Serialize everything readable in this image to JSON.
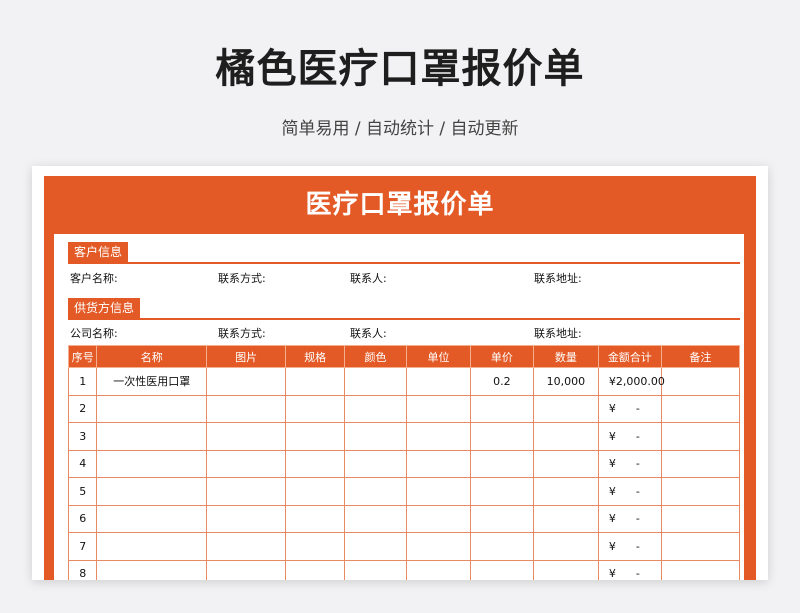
{
  "header": {
    "title": "橘色医疗口罩报价单",
    "subtitle": "简单易用 / 自动统计 / 自动更新"
  },
  "sheet": {
    "title": "医疗口罩报价单",
    "customer": {
      "label": "客户信息",
      "name_label": "客户名称:",
      "contact_method_label": "联系方式:",
      "contact_person_label": "联系人:",
      "address_label": "联系地址:"
    },
    "supplier": {
      "label": "供货方信息",
      "name_label": "公司名称:",
      "contact_method_label": "联系方式:",
      "contact_person_label": "联系人:",
      "address_label": "联系地址:"
    },
    "table": {
      "headers": [
        "序号",
        "名称",
        "图片",
        "规格",
        "颜色",
        "单位",
        "单价",
        "数量",
        "金额合计",
        "备注"
      ],
      "rows": [
        {
          "no": "1",
          "name": "一次性医用口罩",
          "price": "0.2",
          "qty": "10,000",
          "currency": "¥",
          "amount": "2,000.00"
        },
        {
          "no": "2",
          "name": "",
          "price": "",
          "qty": "",
          "currency": "¥",
          "amount": "-"
        },
        {
          "no": "3",
          "name": "",
          "price": "",
          "qty": "",
          "currency": "¥",
          "amount": "-"
        },
        {
          "no": "4",
          "name": "",
          "price": "",
          "qty": "",
          "currency": "¥",
          "amount": "-"
        },
        {
          "no": "5",
          "name": "",
          "price": "",
          "qty": "",
          "currency": "¥",
          "amount": "-"
        },
        {
          "no": "6",
          "name": "",
          "price": "",
          "qty": "",
          "currency": "¥",
          "amount": "-"
        },
        {
          "no": "7",
          "name": "",
          "price": "",
          "qty": "",
          "currency": "¥",
          "amount": "-"
        },
        {
          "no": "8",
          "name": "",
          "price": "",
          "qty": "",
          "currency": "¥",
          "amount": "-"
        }
      ]
    }
  },
  "colors": {
    "accent": "#e35a26",
    "background": "#f2f2f4"
  }
}
